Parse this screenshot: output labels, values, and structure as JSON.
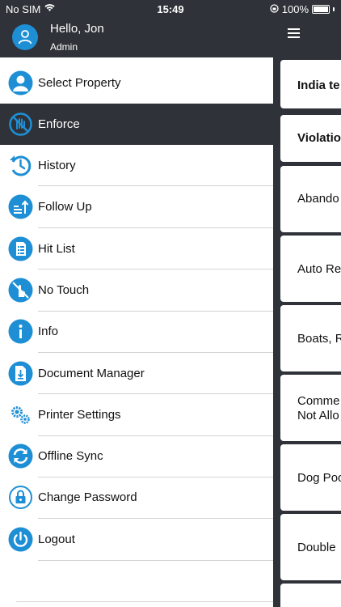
{
  "status_bar": {
    "carrier": "No SIM",
    "time": "15:49",
    "battery": "100%"
  },
  "header": {
    "greeting": "Hello, Jon",
    "role": "Admin"
  },
  "menu": {
    "items": [
      {
        "label": "Select Property",
        "icon": "person-icon"
      },
      {
        "label": "Enforce",
        "icon": "stop-hand-icon"
      },
      {
        "label": "History",
        "icon": "history-icon"
      },
      {
        "label": "Follow Up",
        "icon": "follow-up-icon"
      },
      {
        "label": "Hit List",
        "icon": "list-document-icon"
      },
      {
        "label": "No Touch",
        "icon": "no-touch-icon"
      },
      {
        "label": "Info",
        "icon": "info-icon"
      },
      {
        "label": "Document Manager",
        "icon": "document-download-icon"
      },
      {
        "label": "Printer Settings",
        "icon": "gears-icon"
      },
      {
        "label": "Offline Sync",
        "icon": "sync-icon"
      },
      {
        "label": "Change Password",
        "icon": "lock-icon"
      },
      {
        "label": "Logout",
        "icon": "power-icon"
      }
    ],
    "active_index": 1
  },
  "background": {
    "cards": [
      "India te",
      "Violatio",
      "Abando",
      "Auto Re",
      "Boats, R",
      "Comme",
      "Not Allo",
      "Dog Poo",
      "Double"
    ]
  },
  "colors": {
    "accent": "#1e8fd5",
    "dark": "#2f3238"
  }
}
